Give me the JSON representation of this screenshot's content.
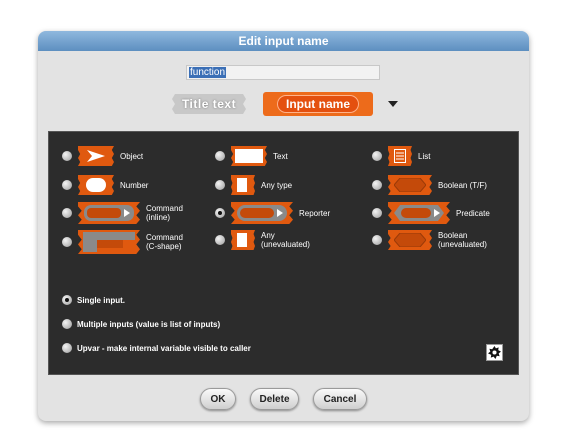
{
  "dialog": {
    "title": "Edit input name",
    "name_value": "function"
  },
  "mode": {
    "title_text": "Title text",
    "input_name": "Input name"
  },
  "types": [
    {
      "label": "Object",
      "icon": "object-arrow-icon"
    },
    {
      "label": "Text",
      "icon": "text-icon"
    },
    {
      "label": "List",
      "icon": "list-icon"
    },
    {
      "label": "Number",
      "icon": "number-icon"
    },
    {
      "label": "Any type",
      "icon": "any-type-icon"
    },
    {
      "label": "Boolean (T/F)",
      "icon": "boolean-icon"
    },
    {
      "label": "Command\n(inline)",
      "icon": "command-inline-icon"
    },
    {
      "label": "Reporter",
      "icon": "reporter-icon",
      "selected": true
    },
    {
      "label": "Predicate",
      "icon": "predicate-icon"
    },
    {
      "label": "Command\n(C-shape)",
      "icon": "command-c-shape-icon"
    },
    {
      "label": "Any\n(unevaluated)",
      "icon": "any-unevaluated-icon"
    },
    {
      "label": "Boolean\n(unevaluated)",
      "icon": "boolean-unevaluated-icon"
    }
  ],
  "options": {
    "single": "Single input.",
    "multiple": "Multiple inputs (value is list of inputs)",
    "upvar": "Upvar - make internal variable visible to caller"
  },
  "buttons": {
    "ok": "OK",
    "delete": "Delete",
    "cancel": "Cancel"
  },
  "colors": {
    "accent": "#e0590f",
    "panel": "#2c2c2c",
    "titlebar": "#6f9ccb"
  }
}
